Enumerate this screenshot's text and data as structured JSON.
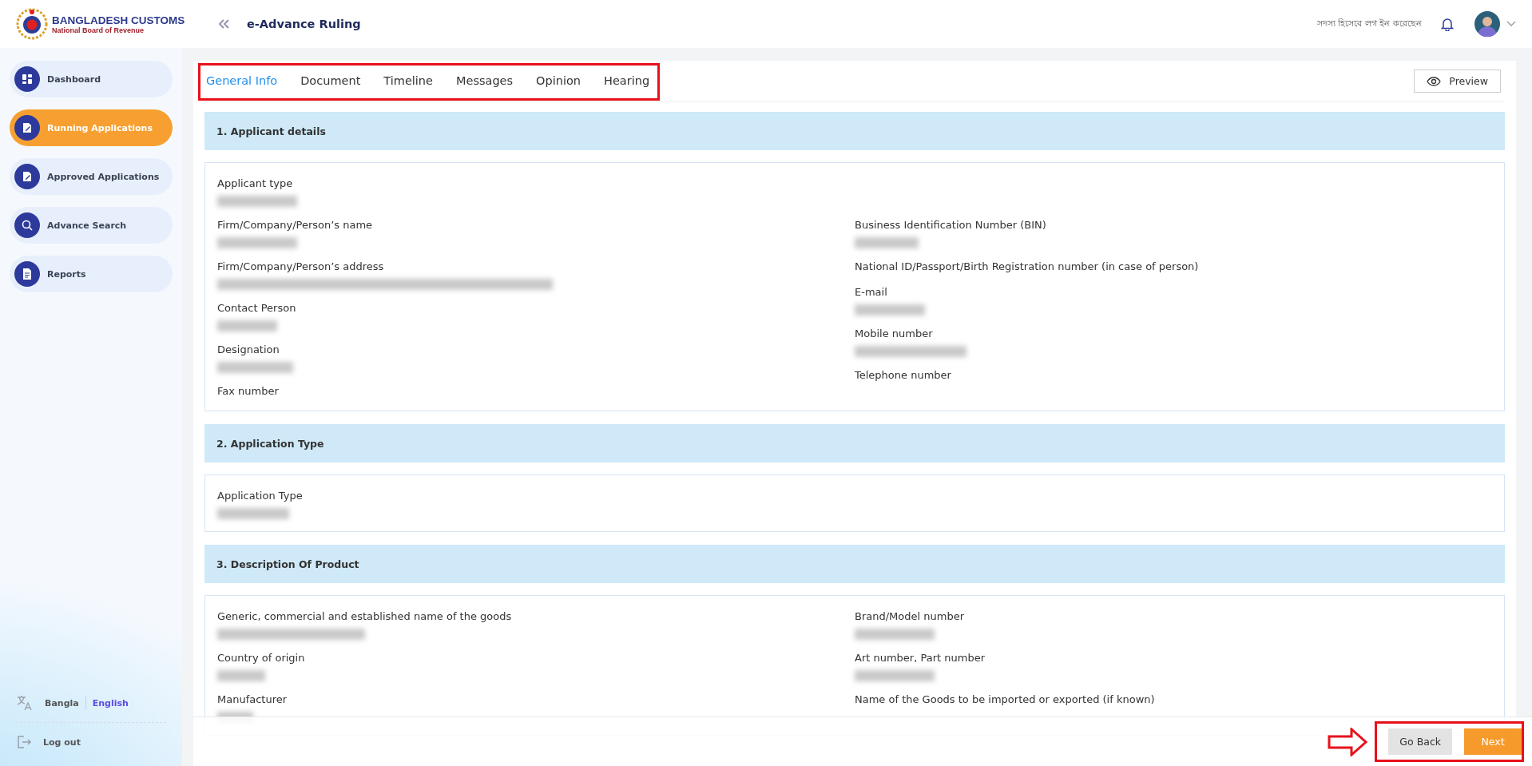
{
  "header": {
    "logo_title": "BANGLADESH CUSTOMS",
    "logo_subtitle": "National Board of Revenue",
    "page_title": "e-Advance Ruling",
    "login_status": "সদস্য হিসেবে লগ ইন করেছেন"
  },
  "sidebar": {
    "items": [
      {
        "label": "Dashboard",
        "kind": "grid",
        "selected": false
      },
      {
        "label": "Running Applications",
        "kind": "edit",
        "selected": true
      },
      {
        "label": "Approved Applications",
        "kind": "edit",
        "selected": false
      },
      {
        "label": "Advance Search",
        "kind": "search",
        "selected": false
      },
      {
        "label": "Reports",
        "kind": "document",
        "selected": false
      }
    ],
    "languages": [
      {
        "label": "Bangla",
        "selected": false
      },
      {
        "label": "English",
        "selected": true
      }
    ],
    "logout": "Log out"
  },
  "tabs": [
    {
      "label": "General Info",
      "selected": true
    },
    {
      "label": "Document",
      "selected": false
    },
    {
      "label": "Timeline",
      "selected": false
    },
    {
      "label": "Messages",
      "selected": false
    },
    {
      "label": "Opinion",
      "selected": false
    },
    {
      "label": "Hearing",
      "selected": false
    }
  ],
  "preview_button": "Preview",
  "sections": [
    {
      "title": "1. Applicant details",
      "lead_fields": [
        {
          "label": "Applicant type",
          "redacted": true
        }
      ],
      "left_fields": [
        {
          "label": "Firm/Company/Person’s name",
          "redacted": true
        },
        {
          "label": "Firm/Company/Person’s address",
          "redacted": true
        },
        {
          "label": "Contact Person",
          "redacted": true
        },
        {
          "label": "Designation",
          "redacted": true
        },
        {
          "label": "Fax number",
          "redacted": false
        }
      ],
      "right_fields": [
        {
          "label": "Business Identification Number (BIN)",
          "redacted": true
        },
        {
          "label": "National ID/Passport/Birth Registration number (in case of person)",
          "redacted": false
        },
        {
          "label": "E-mail",
          "redacted": true
        },
        {
          "label": "Mobile number",
          "redacted": true
        },
        {
          "label": "Telephone number",
          "redacted": false
        }
      ]
    },
    {
      "title": "2. Application Type",
      "lead_fields": [
        {
          "label": "Application Type",
          "redacted": true
        }
      ]
    },
    {
      "title": "3. Description Of Product",
      "left_fields": [
        {
          "label": "Generic, commercial and established name of the goods",
          "redacted": true
        },
        {
          "label": "Country of origin",
          "redacted": true
        },
        {
          "label": "Manufacturer",
          "redacted": true
        }
      ],
      "right_fields": [
        {
          "label": "Brand/Model number",
          "redacted": true
        },
        {
          "label": "Art number, Part number",
          "redacted": true
        },
        {
          "label": "Name of the Goods to be imported or exported (if known)",
          "redacted": false
        }
      ]
    }
  ],
  "footer": {
    "buttons": [
      {
        "label": "Go Back",
        "kind": "secondary"
      },
      {
        "label": "Next",
        "kind": "primary"
      }
    ]
  }
}
